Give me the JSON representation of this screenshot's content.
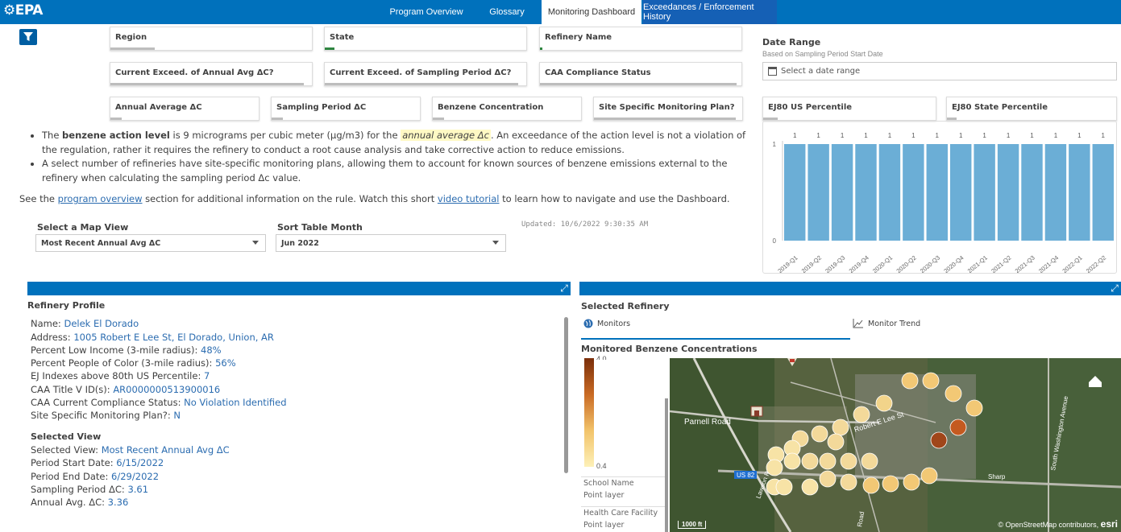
{
  "header": {
    "logo": "⚙EPA",
    "nav": [
      "Program Overview",
      "Glossary",
      "Monitoring Dashboard",
      "Exceedances / Enforcement History"
    ]
  },
  "filters": {
    "row1": [
      "Region",
      "State",
      "Refinery Name"
    ],
    "row2": [
      "Current Exceed. of Annual Avg ΔC?",
      "Current Exceed. of Sampling Period ΔC?",
      "CAA Compliance Status"
    ],
    "row3": [
      "Annual Average ΔC",
      "Sampling Period ΔC",
      "Benzene Concentration",
      "Site Specific Monitoring Plan?"
    ],
    "ej": [
      "EJ80 US Percentile",
      "EJ80 State Percentile"
    ],
    "date_range": {
      "title": "Date Range",
      "subtitle": "Based on Sampling Period Start Date",
      "placeholder": "Select a date range"
    }
  },
  "info": {
    "b1_pre": "The ",
    "b1_bold": "benzene action level",
    "b1_mid": " is 9 micrograms per cubic meter (µg/m3) for the ",
    "b1_hl": "annual average Δc",
    "b1_post": ". An exceedance of the action level is not a violation of the regulation, rather it requires the refinery to conduct a root cause analysis and take corrective action to reduce emissions.",
    "b2": "A select number of refineries have site-specific monitoring plans, allowing them to account for known sources of benzene emissions external to the refinery when calculating the sampling period Δc value.",
    "see_pre": "See the ",
    "see_link1": "program overview",
    "see_mid": " section for additional information on the rule. Watch this short ",
    "see_link2": "video tutorial",
    "see_post": " to learn how to navigate and use the Dashboard."
  },
  "controls": {
    "map_view_label": "Select a Map View",
    "map_view_value": "Most Recent Annual Avg ΔC",
    "sort_label": "Sort Table Month",
    "sort_value": "Jun 2022",
    "updated": "Updated: 10/6/2022 9:30:35 AM"
  },
  "chart_data": {
    "type": "bar",
    "categories": [
      "2019-Q1",
      "2019-Q2",
      "2019-Q3",
      "2019-Q4",
      "2020-Q1",
      "2020-Q2",
      "2020-Q3",
      "2020-Q4",
      "2021-Q1",
      "2021-Q2",
      "2021-Q3",
      "2021-Q4",
      "2022-Q1",
      "2022-Q2"
    ],
    "values": [
      1,
      1,
      1,
      1,
      1,
      1,
      1,
      1,
      1,
      1,
      1,
      1,
      1,
      1
    ],
    "yticks": [
      0,
      1
    ],
    "ylim": [
      0,
      1
    ],
    "bar_color": "#6baed6"
  },
  "profile": {
    "title": "Refinery Profile",
    "fields": [
      {
        "label": "Name: ",
        "value": "Delek El Dorado"
      },
      {
        "label": "Address: ",
        "value": "1005 Robert E Lee St, El Dorado, Union, AR"
      },
      {
        "label": "Percent Low Income (3-mile radius): ",
        "value": "48%"
      },
      {
        "label": "Percent People of Color (3-mile radius): ",
        "value": "56%"
      },
      {
        "label": "EJ Indexes above 80th US Percentile: ",
        "value": "7"
      },
      {
        "label": "CAA Title V ID(s): ",
        "value": "AR0000000513900016"
      },
      {
        "label": "CAA Current Compliance Status: ",
        "value": "No Violation Identified"
      },
      {
        "label": "Site Specific Monitoring Plan?: ",
        "value": "N"
      }
    ],
    "view_title": "Selected View",
    "view_fields": [
      {
        "label": "Selected View: ",
        "value": "Most Recent Annual Avg ΔC"
      },
      {
        "label": "Period Start Date: ",
        "value": "6/15/2022"
      },
      {
        "label": "Period End Date: ",
        "value": "6/29/2022"
      },
      {
        "label": "Sampling Period ΔC: ",
        "value": "3.61"
      },
      {
        "label": "Annual Avg. ΔC: ",
        "value": "3.36"
      }
    ]
  },
  "map_panel": {
    "title": "Selected Refinery",
    "tab_monitors": "Monitors",
    "tab_trend": "Monitor Trend",
    "subtitle": "Monitored Benzene Concentrations",
    "legend_top": "4.0",
    "legend_bottom": "0.4",
    "layers": [
      {
        "name": "School Name",
        "type": "Point layer"
      },
      {
        "name": "Health Care Facility",
        "type": "Point layer"
      }
    ],
    "roads": [
      "Parnell Road",
      "Robert E Lee St",
      "US 82",
      "Sharp",
      "South Washington Avenue",
      "Lawson Road",
      "Road"
    ],
    "scale": "1000 ft",
    "attribution": "© OpenStreetMap contributors,",
    "esri": "esri"
  }
}
